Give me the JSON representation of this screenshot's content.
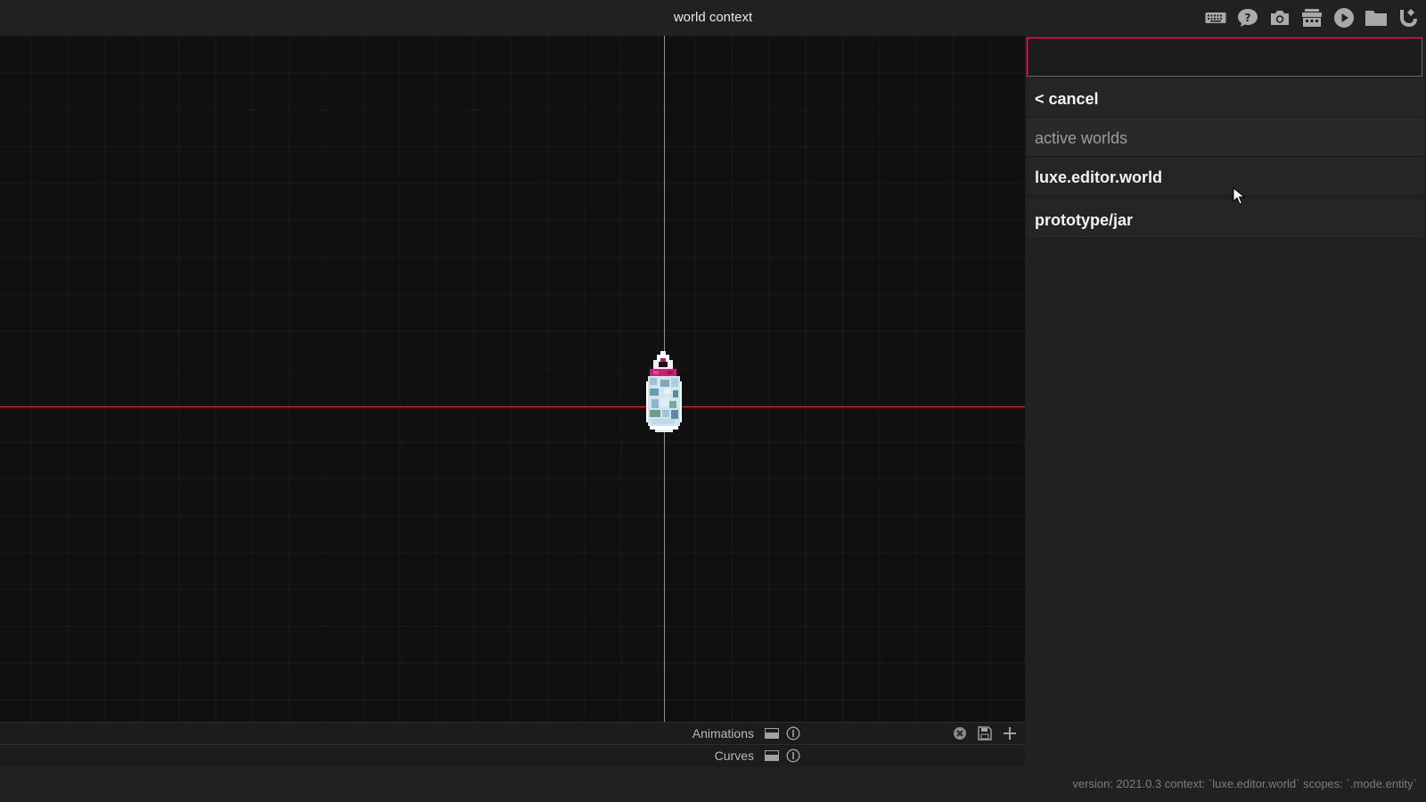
{
  "header": {
    "title": "world context"
  },
  "toolbar": {
    "icons": [
      "keyboard-icon",
      "help-icon",
      "camera-icon",
      "toolbox-icon",
      "play-icon",
      "folder-icon",
      "luxe-logo-icon"
    ]
  },
  "panel": {
    "search_value": "",
    "accent_color": "#e3256b",
    "items": [
      {
        "label": "< cancel",
        "kind": "action"
      },
      {
        "label": "active worlds",
        "kind": "header"
      },
      {
        "label": "luxe.editor.world",
        "kind": "option"
      },
      {
        "label": "prototype/jar",
        "kind": "option"
      }
    ]
  },
  "timeline": {
    "animations_label": "Animations",
    "curves_label": "Curves"
  },
  "viewport": {
    "x_axis_color": "#e0213e",
    "y_axis_color": "#2bd63a"
  },
  "status": {
    "text": "version: 2021.0.3 context: `luxe.editor.world` scopes: `.mode.entity`"
  }
}
